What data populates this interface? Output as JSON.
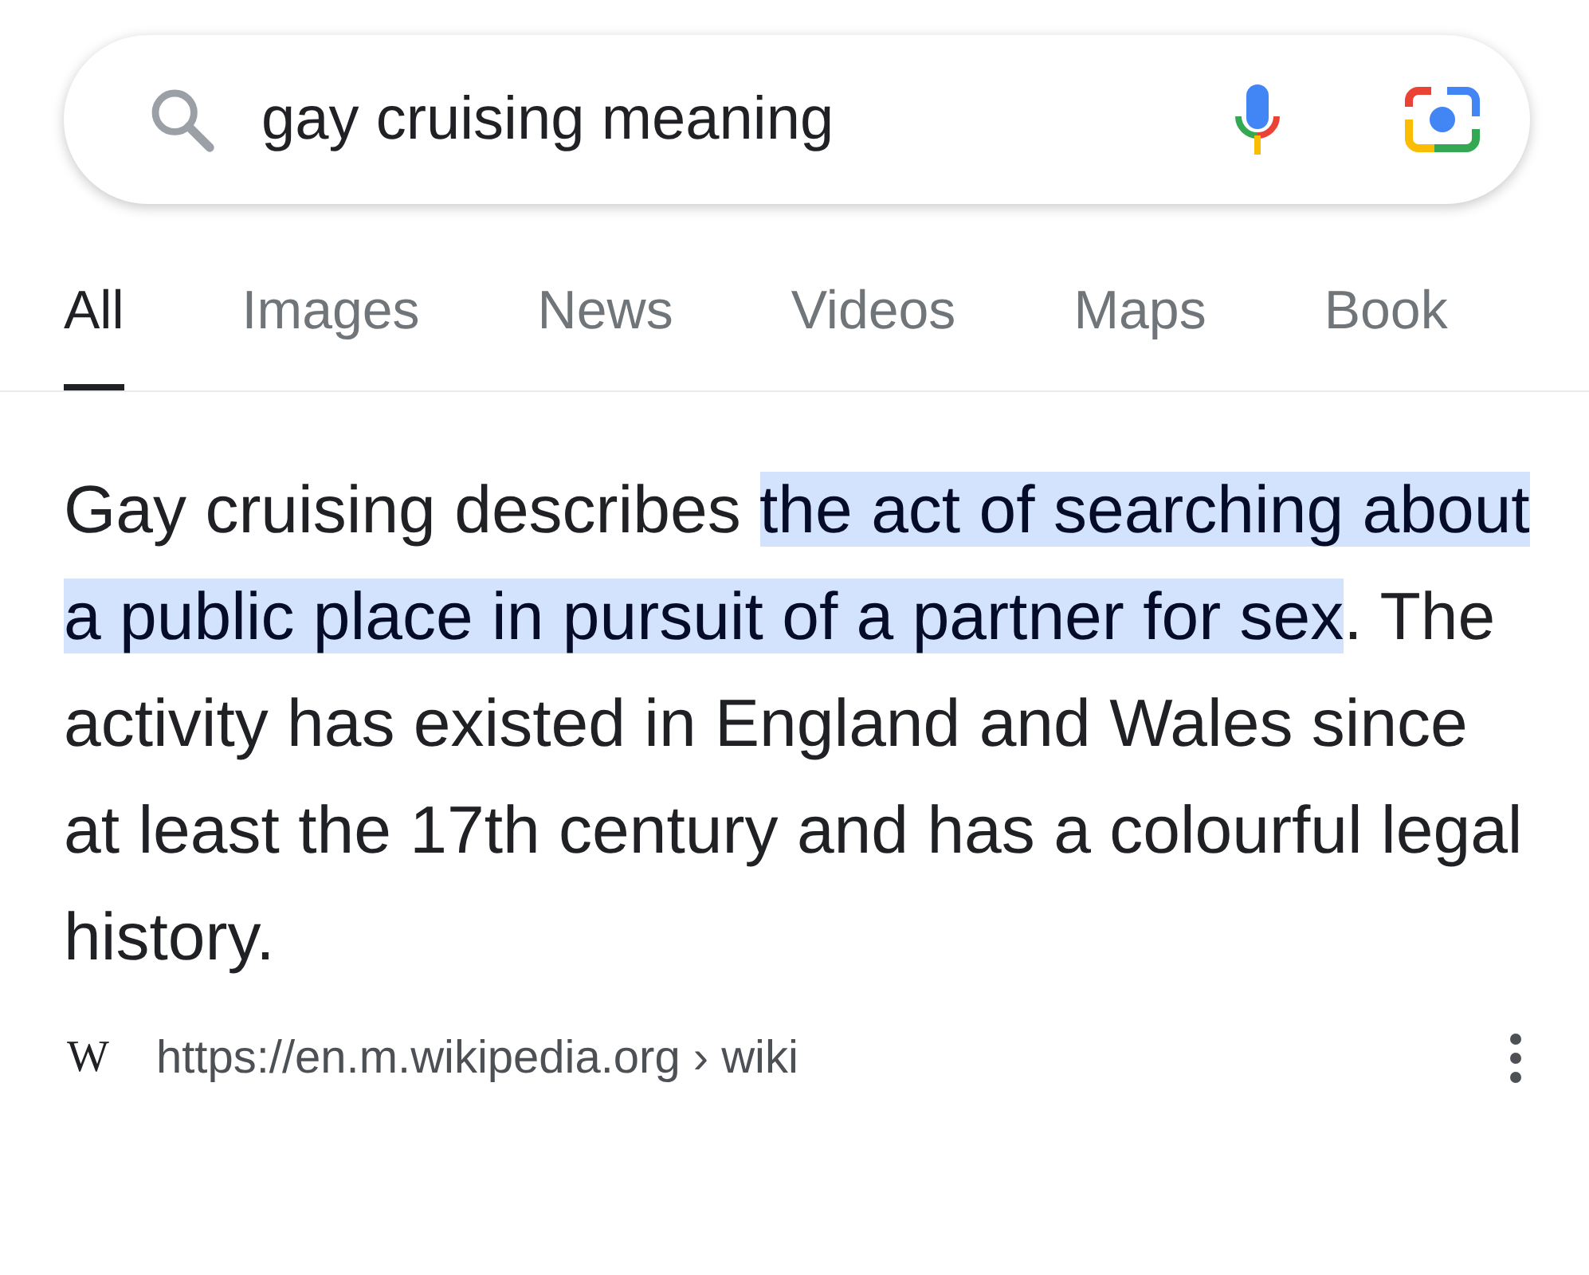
{
  "search": {
    "value": "gay cruising meaning"
  },
  "tabs": [
    {
      "label": "All",
      "selected": true
    },
    {
      "label": "Images",
      "selected": false
    },
    {
      "label": "News",
      "selected": false
    },
    {
      "label": "Videos",
      "selected": false
    },
    {
      "label": "Maps",
      "selected": false
    },
    {
      "label": "Book",
      "selected": false
    }
  ],
  "snippet": "Gay cruising describes **the act of searching about a public place in pursuit of a partner for sex**. The activity has existed in England and Wales since at least the 17th century and has a colourful legal history.",
  "source": {
    "favicon": "W",
    "url": "https://en.m.wikipedia.org › wiki"
  }
}
